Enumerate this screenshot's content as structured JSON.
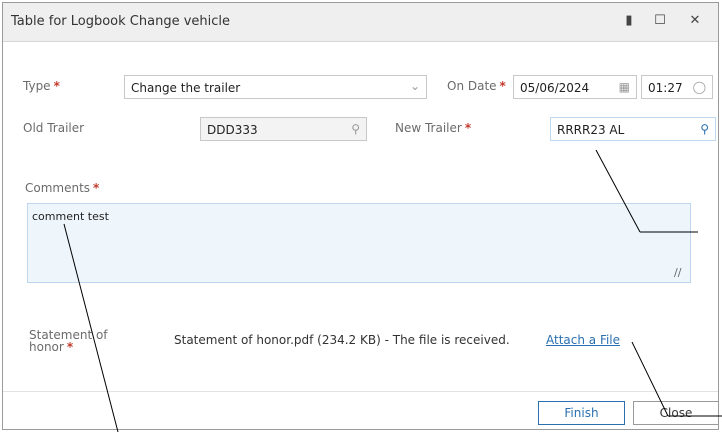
{
  "dialog": {
    "title": "Table for Logbook Change vehicle",
    "window_icons": [
      "pin-icon",
      "maximize-icon",
      "close-icon"
    ]
  },
  "form": {
    "type": {
      "label": "Type",
      "value": "Change the trailer"
    },
    "on_date": {
      "label": "On Date",
      "date": "05/06/2024",
      "time": "01:27"
    },
    "old_trailer": {
      "label": "Old Trailer",
      "value": "DDD333"
    },
    "new_trailer": {
      "label": "New Trailer",
      "value": "RRRR23 AL"
    },
    "comments": {
      "label": "Comments",
      "value": "comment test"
    },
    "statement": {
      "label_line1": "Statement of",
      "label_line2": "honor",
      "text": "Statement of honor.pdf (234.2 KB) - The file is received.",
      "attach_link": "Attach a File"
    },
    "required_marker": "*"
  },
  "footer": {
    "finish_label": "Finish",
    "close_label": "Close"
  },
  "colors": {
    "accent": "#2a6fb0",
    "required": "#c0392b",
    "title_bg": "#efefef"
  }
}
